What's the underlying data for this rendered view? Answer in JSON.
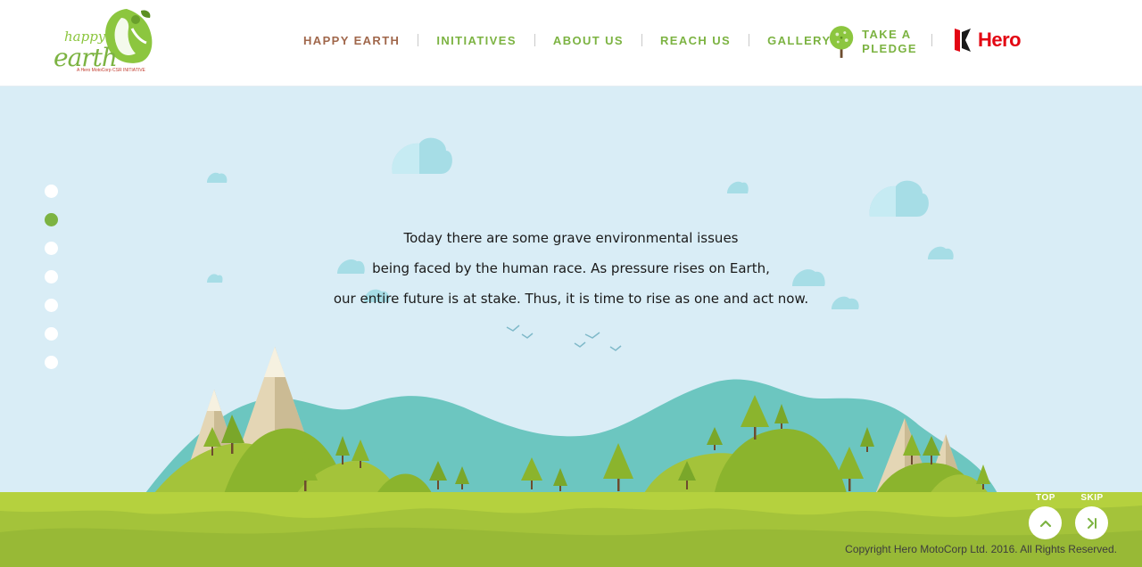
{
  "header": {
    "logo": {
      "happy": "happy",
      "earth": "earth",
      "tagline": "A Hero MotoCorp CSR INITIATIVE",
      "icon": "hand-leaf-logo-icon"
    },
    "nav": [
      {
        "label": "HAPPY EARTH",
        "active": true
      },
      {
        "label": "INITIATIVES",
        "active": false
      },
      {
        "label": "ABOUT US",
        "active": false
      },
      {
        "label": "REACH US",
        "active": false
      },
      {
        "label": "GALLERY",
        "active": false
      }
    ],
    "pledge": {
      "line1": "TAKE A",
      "line2": "PLEDGE",
      "icon": "tree-icon"
    },
    "brand": {
      "word": "Hero",
      "icon": "hero-h-icon"
    }
  },
  "scene": {
    "slide_count": 7,
    "active_slide": 2,
    "message": [
      "Today there are some grave environmental issues",
      "being faced by the human race. As pressure rises on Earth,",
      "our entire future is at stake. Thus, it is time to rise as one and act now."
    ]
  },
  "controls": {
    "top_label": "TOP",
    "skip_label": "SKIP",
    "top_icon": "chevron-up-icon",
    "skip_icon": "skip-next-icon"
  },
  "footer": {
    "copyright": "Copyright Hero MotoCorp Ltd. 2016. All Rights Reserved."
  },
  "colors": {
    "sky": "#d9edf6",
    "green": "#7cb342",
    "active_nav": "#a0674b",
    "teal": "#6cc6c0",
    "ground": "#a4c33a",
    "hero_red": "#e30613"
  }
}
